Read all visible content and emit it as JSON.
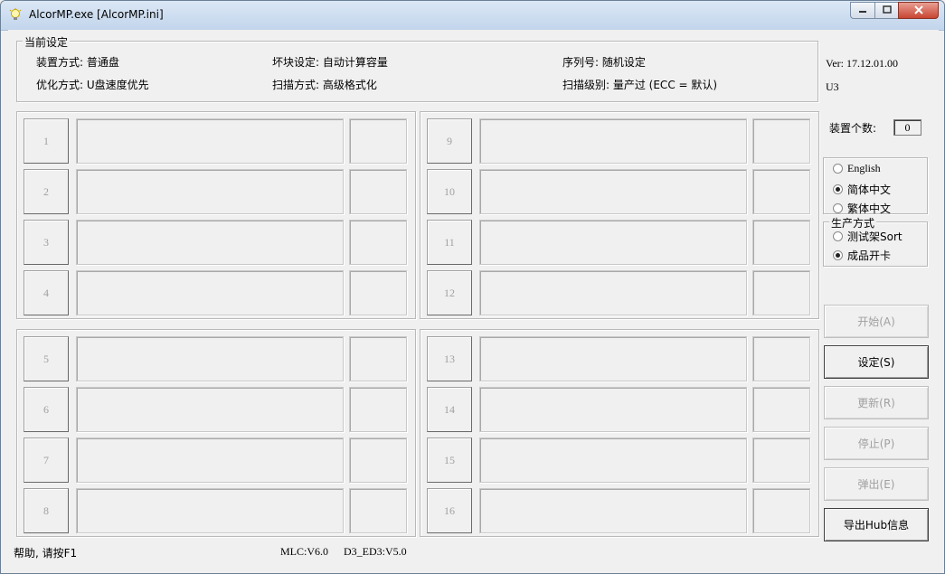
{
  "window": {
    "title": "AlcorMP.exe [AlcorMP.ini]",
    "accent": "#c2d5ec",
    "close_color": "#c84532"
  },
  "settings_group": {
    "legend": "当前设定",
    "install_mode": "装置方式: 普通盘",
    "bad_block": "坏块设定: 自动计算容量",
    "serial": "序列号: 随机设定",
    "optimize": "优化方式: U盘速度优先",
    "scan_mode": "扫描方式: 高级格式化",
    "scan_level": "扫描级别: 量产过 (ECC = 默认)"
  },
  "version": {
    "ver": "Ver: 17.12.01.00",
    "model": "U3"
  },
  "device_count": {
    "label": "装置个数:",
    "value": "0"
  },
  "slots": [
    {
      "num": "1"
    },
    {
      "num": "2"
    },
    {
      "num": "3"
    },
    {
      "num": "4"
    },
    {
      "num": "5"
    },
    {
      "num": "6"
    },
    {
      "num": "7"
    },
    {
      "num": "8"
    },
    {
      "num": "9"
    },
    {
      "num": "10"
    },
    {
      "num": "11"
    },
    {
      "num": "12"
    },
    {
      "num": "13"
    },
    {
      "num": "14"
    },
    {
      "num": "15"
    },
    {
      "num": "16"
    }
  ],
  "language": {
    "options": [
      {
        "label": "English",
        "selected": false
      },
      {
        "label": "简体中文",
        "selected": true
      },
      {
        "label": "繁体中文",
        "selected": false
      }
    ]
  },
  "production": {
    "legend": "生产方式",
    "options": [
      {
        "label": "测试架Sort",
        "selected": false
      },
      {
        "label": "成品开卡",
        "selected": true
      }
    ]
  },
  "buttons": {
    "start": "开始(A)",
    "settings": "设定(S)",
    "refresh": "更新(R)",
    "stop": "停止(P)",
    "eject": "弹出(E)",
    "export_hub": "导出Hub信息"
  },
  "status": {
    "help": "帮助, 请按F1",
    "mlc": "MLC:V6.0",
    "d3": "D3_ED3:V5.0"
  },
  "icons": {
    "app": "lightbulb-icon",
    "minimize": "minimize-icon",
    "maximize": "maximize-icon",
    "close": "close-icon"
  }
}
